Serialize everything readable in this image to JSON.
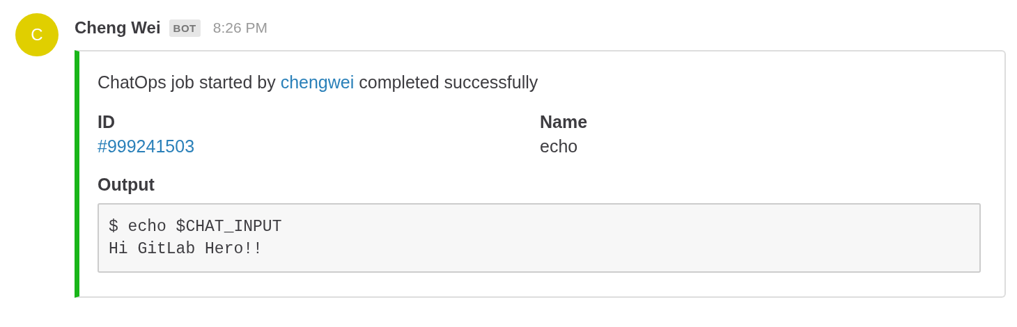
{
  "message": {
    "avatar": {
      "initial": "C"
    },
    "author": "Cheng Wei",
    "badge": "BOT",
    "time": "8:26 PM",
    "attachment": {
      "summary": {
        "before": "ChatOps job started by ",
        "link": "chengwei",
        "after": " completed successfully"
      },
      "fields": [
        {
          "title": "ID",
          "value": "#999241503",
          "link": true
        },
        {
          "title": "Name",
          "value": "echo",
          "link": false
        }
      ],
      "output": {
        "title": "Output",
        "lines": [
          "$ echo $CHAT_INPUT",
          "Hi GitLab Hero!!"
        ]
      }
    }
  }
}
